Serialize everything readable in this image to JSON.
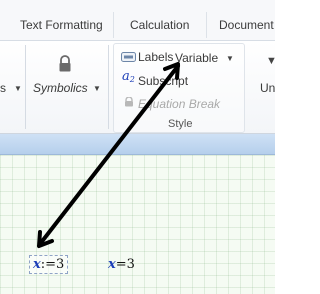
{
  "tabs": [
    "Text Formatting",
    "Calculation",
    "Document"
  ],
  "ribbon": {
    "left_cut_label": "s",
    "symbols_label": "Symbolics",
    "style_group": {
      "labels_label": "Labels",
      "labels_value": "Variable",
      "subscript_label": "Subscript",
      "equation_break_label": "Equation Break",
      "group_title": "Style"
    },
    "right_cut_label": "Un"
  },
  "worksheet": {
    "regions": [
      {
        "var": "x",
        "op": ":=",
        "value": "3",
        "selected": true
      },
      {
        "var": "x",
        "op": "=",
        "value": "3",
        "selected": false
      }
    ]
  },
  "colors": {
    "accent_blue": "#1d3fb8",
    "blue_bar": "#bfd5ef",
    "worksheet_bg": "#f5fbf3"
  },
  "icons": [
    "lock-icon",
    "labels-icon",
    "subscript-icon",
    "equation-break-icon",
    "dropdown-arrow-icon"
  ]
}
